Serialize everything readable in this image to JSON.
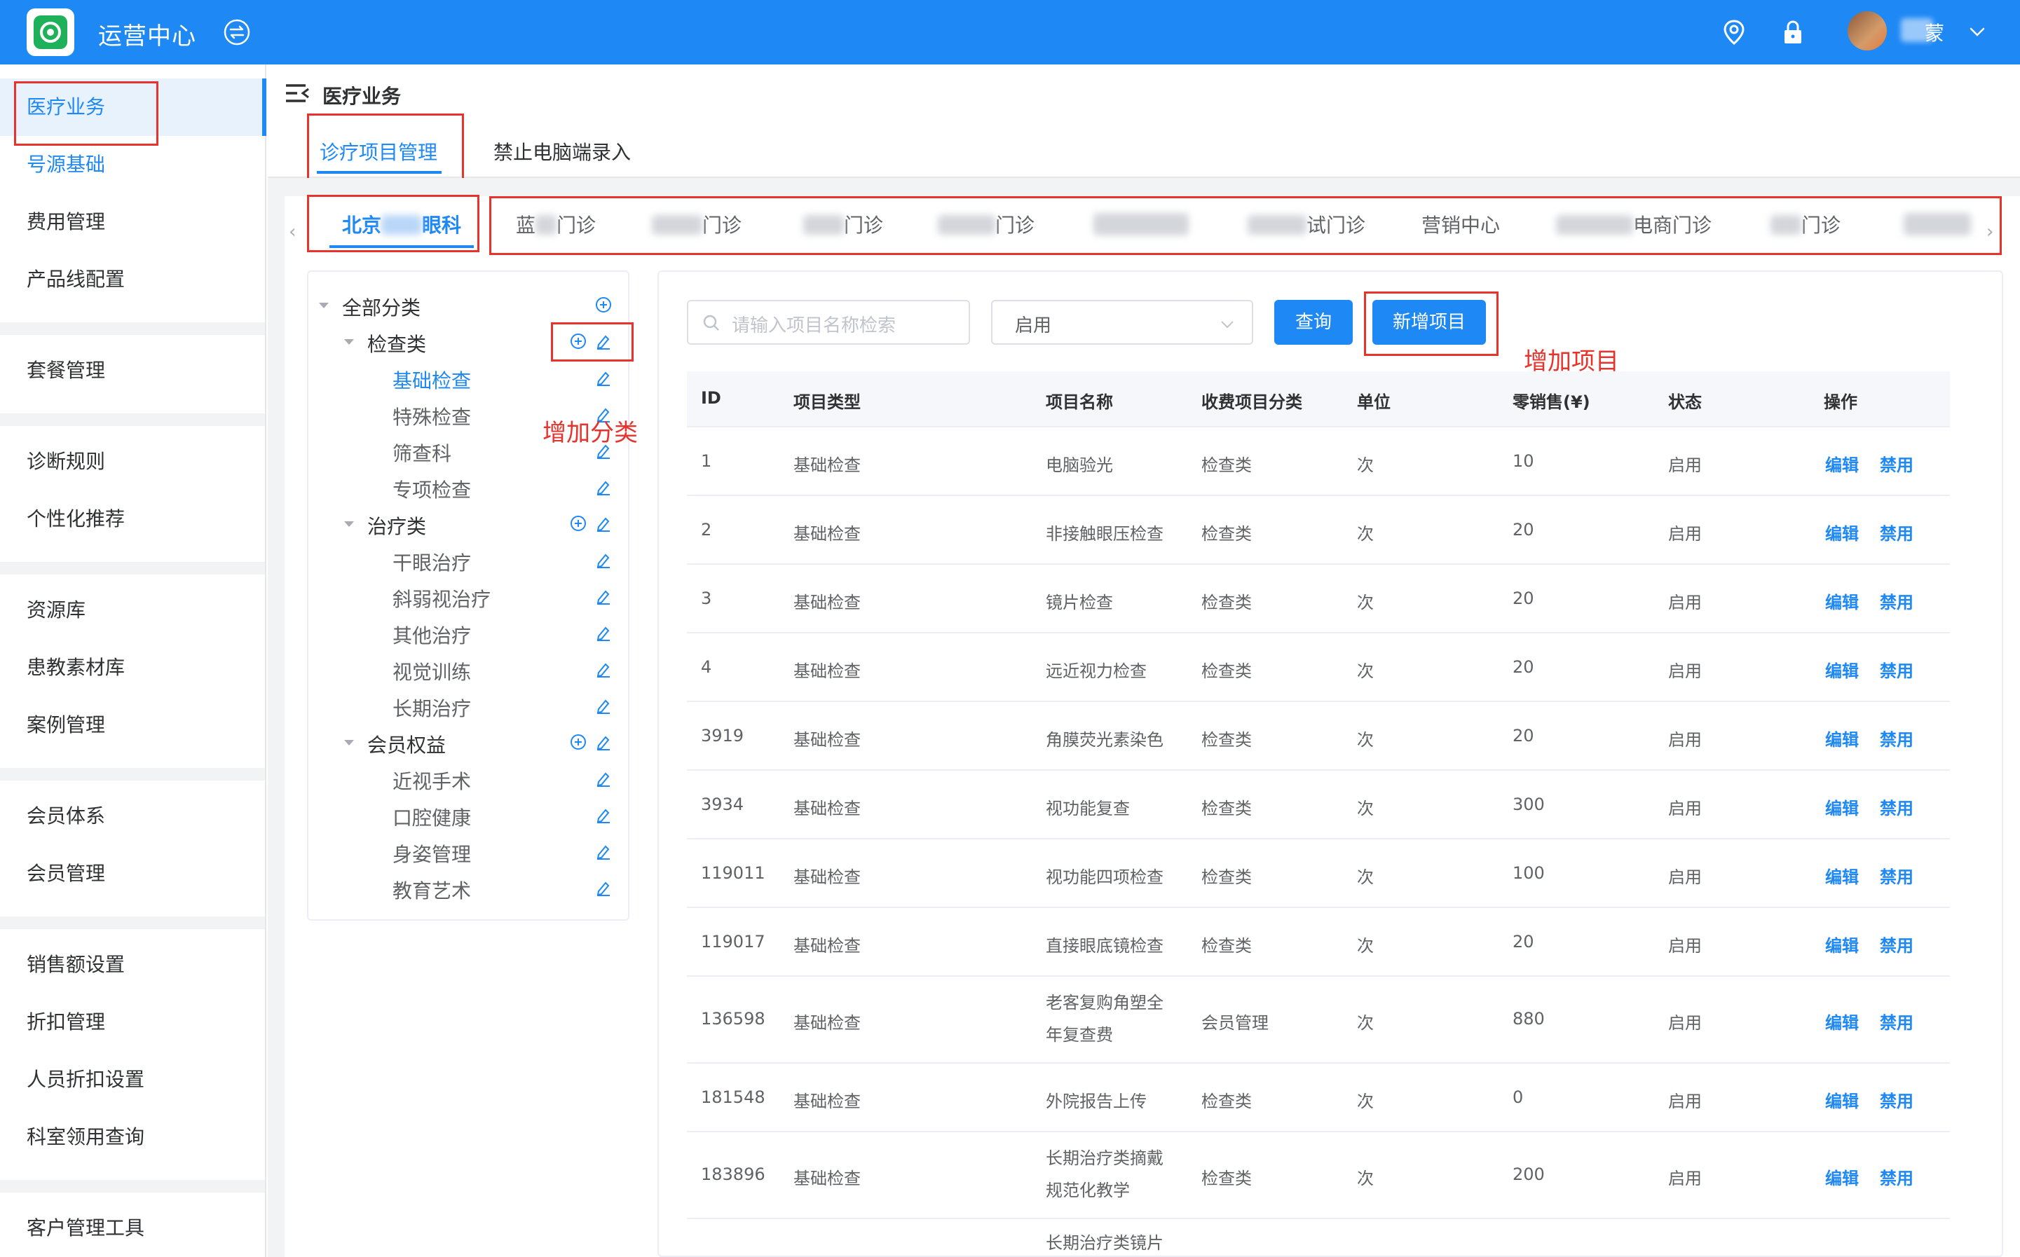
{
  "header": {
    "app_title": "运营中心",
    "user_name": "蒙",
    "icons": [
      "app-logo-icon",
      "switch-icon",
      "location-icon",
      "lock-icon",
      "avatar",
      "chevron-down-icon"
    ],
    "bg_color": "#1e88f5"
  },
  "sidebar": {
    "items": [
      {
        "label": "医疗业务"
      },
      {
        "label": "号源基础"
      },
      {
        "label": "费用管理"
      },
      {
        "label": "产品线配置"
      },
      {
        "label": "套餐管理"
      },
      {
        "label": "诊断规则"
      },
      {
        "label": "个性化推荐"
      },
      {
        "label": "资源库"
      },
      {
        "label": "患教素材库"
      },
      {
        "label": "案例管理"
      },
      {
        "label": "会员体系"
      },
      {
        "label": "会员管理"
      },
      {
        "label": "销售额设置"
      },
      {
        "label": "折扣管理"
      },
      {
        "label": "人员折扣设置"
      },
      {
        "label": "科室领用查询"
      },
      {
        "label": "客户管理工具"
      }
    ]
  },
  "page": {
    "title": "医疗业务",
    "tabs": [
      {
        "label": "诊疗项目管理",
        "active": true
      },
      {
        "label": "禁止电脑端录入",
        "active": false
      }
    ],
    "clinic_tabs": [
      {
        "label_a": "北京",
        "label_b": "眼科",
        "active": true
      },
      {
        "label_a": "蓝",
        "label_b": "门诊"
      },
      {
        "label_a": "",
        "label_b": "门诊"
      },
      {
        "label_a": "",
        "label_b": "门诊"
      },
      {
        "label_a": "",
        "label_b": "门诊"
      },
      {
        "label_a": "",
        "label_b": ""
      },
      {
        "label_a": "",
        "label_b": "试门诊"
      },
      {
        "label_a": "营销中心",
        "label_b": ""
      },
      {
        "label_a": "",
        "label_b": "电商门诊"
      },
      {
        "label_a": "",
        "label_b": "门诊"
      },
      {
        "label_a": "",
        "label_b": ""
      }
    ]
  },
  "tree": {
    "root": "全部分类",
    "nodes": [
      {
        "label": "检查类",
        "level": 1
      },
      {
        "label": "基础检查",
        "level": 2,
        "selected": true
      },
      {
        "label": "特殊检查",
        "level": 2
      },
      {
        "label": "筛查科",
        "level": 2
      },
      {
        "label": "专项检查",
        "level": 2
      },
      {
        "label": "治疗类",
        "level": 1
      },
      {
        "label": "干眼治疗",
        "level": 2
      },
      {
        "label": "斜弱视治疗",
        "level": 2
      },
      {
        "label": "其他治疗",
        "level": 2
      },
      {
        "label": "视觉训练",
        "level": 2
      },
      {
        "label": "长期治疗",
        "level": 2
      },
      {
        "label": "会员权益",
        "level": 1
      },
      {
        "label": "近视手术",
        "level": 2
      },
      {
        "label": "口腔健康",
        "level": 2
      },
      {
        "label": "身姿管理",
        "level": 2
      },
      {
        "label": "教育艺术",
        "level": 2
      }
    ]
  },
  "annotations": {
    "add_category": "增加分类",
    "add_item": "增加项目"
  },
  "filters": {
    "search_placeholder": "请输入项目名称检索",
    "status_value": "启用",
    "query_button": "查询",
    "add_button": "新增项目"
  },
  "table": {
    "columns": [
      "ID",
      "项目类型",
      "项目名称",
      "收费项目分类",
      "单位",
      "零销售(¥)",
      "状态",
      "操作"
    ],
    "rows": [
      {
        "id": "1",
        "type": "基础检查",
        "name": "电脑验光",
        "fee": "检查类",
        "unit": "次",
        "price": "10",
        "status": "启用",
        "edit": "编辑",
        "disable": "禁用"
      },
      {
        "id": "2",
        "type": "基础检查",
        "name": "非接触眼压检查",
        "fee": "检查类",
        "unit": "次",
        "price": "20",
        "status": "启用",
        "edit": "编辑",
        "disable": "禁用"
      },
      {
        "id": "3",
        "type": "基础检查",
        "name": "镜片检查",
        "fee": "检查类",
        "unit": "次",
        "price": "20",
        "status": "启用",
        "edit": "编辑",
        "disable": "禁用"
      },
      {
        "id": "4",
        "type": "基础检查",
        "name": "远近视力检查",
        "fee": "检查类",
        "unit": "次",
        "price": "20",
        "status": "启用",
        "edit": "编辑",
        "disable": "禁用"
      },
      {
        "id": "3919",
        "type": "基础检查",
        "name": "角膜荧光素染色",
        "fee": "检查类",
        "unit": "次",
        "price": "20",
        "status": "启用",
        "edit": "编辑",
        "disable": "禁用"
      },
      {
        "id": "3934",
        "type": "基础检查",
        "name": "视功能复查",
        "fee": "检查类",
        "unit": "次",
        "price": "300",
        "status": "启用",
        "edit": "编辑",
        "disable": "禁用"
      },
      {
        "id": "119011",
        "type": "基础检查",
        "name": "视功能四项检查",
        "fee": "检查类",
        "unit": "次",
        "price": "100",
        "status": "启用",
        "edit": "编辑",
        "disable": "禁用"
      },
      {
        "id": "119017",
        "type": "基础检查",
        "name": "直接眼底镜检查",
        "fee": "检查类",
        "unit": "次",
        "price": "20",
        "status": "启用",
        "edit": "编辑",
        "disable": "禁用"
      },
      {
        "id": "136598",
        "type": "基础检查",
        "name": "老客复购角塑全年复查费",
        "fee": "会员管理",
        "unit": "次",
        "price": "880",
        "status": "启用",
        "edit": "编辑",
        "disable": "禁用"
      },
      {
        "id": "181548",
        "type": "基础检查",
        "name": "外院报告上传",
        "fee": "检查类",
        "unit": "次",
        "price": "0",
        "status": "启用",
        "edit": "编辑",
        "disable": "禁用"
      },
      {
        "id": "183896",
        "type": "基础检查",
        "name": "长期治疗类摘戴规范化教学",
        "fee": "检查类",
        "unit": "次",
        "price": "200",
        "status": "启用",
        "edit": "编辑",
        "disable": "禁用"
      },
      {
        "id": "",
        "type": "",
        "name": "长期治疗类镜片",
        "fee": "",
        "unit": "",
        "price": "",
        "status": "",
        "edit": "",
        "disable": ""
      }
    ]
  }
}
